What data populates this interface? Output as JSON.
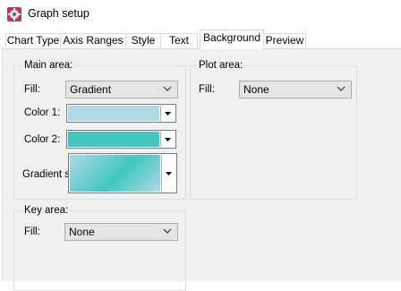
{
  "window": {
    "title": "Graph setup"
  },
  "tabs": [
    {
      "label": "Chart Type"
    },
    {
      "label": "Axis Ranges"
    },
    {
      "label": "Style"
    },
    {
      "label": "Text"
    },
    {
      "label": "Background",
      "active": true
    },
    {
      "label": "Preview"
    }
  ],
  "main_area": {
    "title": "Main area:",
    "fill_label": "Fill:",
    "fill_value": "Gradient",
    "color1_label": "Color 1:",
    "color1": "#add8e6",
    "color2_label": "Color 2:",
    "color2": "#40c8c0",
    "gradient_label": "Gradient style:"
  },
  "plot_area": {
    "title": "Plot area:",
    "fill_label": "Fill:",
    "fill_value": "None"
  },
  "key_area": {
    "title": "Key area:",
    "fill_label": "Fill:",
    "fill_value": "None"
  }
}
